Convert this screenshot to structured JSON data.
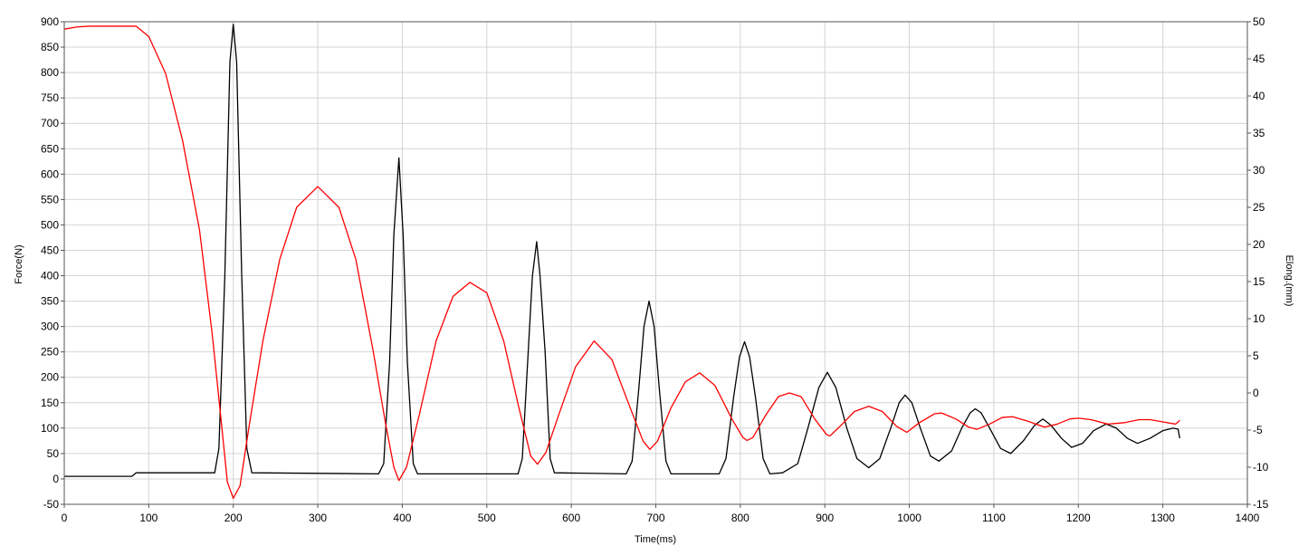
{
  "chart_data": {
    "type": "line",
    "title": "",
    "xlabel": "Time(ms)",
    "ylabel": "Force(N)",
    "y2label": "Elong.(mm)",
    "xlim": [
      0,
      1400
    ],
    "ylim": [
      -50,
      900
    ],
    "y2lim": [
      -15,
      50
    ],
    "grid": true,
    "x_ticks": [
      "0",
      "100",
      "200",
      "300",
      "400",
      "500",
      "600",
      "700",
      "800",
      "900",
      "1000",
      "1100",
      "1200",
      "1300",
      "1400"
    ],
    "y_ticks": [
      "-50",
      "0",
      "50",
      "100",
      "150",
      "200",
      "250",
      "300",
      "350",
      "400",
      "450",
      "500",
      "550",
      "600",
      "650",
      "700",
      "750",
      "800",
      "850",
      "900"
    ],
    "y2_ticks": [
      "-15",
      "-10",
      "-5",
      "0",
      "5",
      "10",
      "15",
      "20",
      "25",
      "30",
      "35",
      "40",
      "45",
      "50"
    ],
    "series": [
      {
        "axis": "left",
        "color": "#000000",
        "points": [
          [
            0,
            5
          ],
          [
            80,
            5
          ],
          [
            85,
            12
          ],
          [
            178,
            12
          ],
          [
            183,
            60
          ],
          [
            190,
            400
          ],
          [
            196,
            820
          ],
          [
            200,
            895
          ],
          [
            204,
            820
          ],
          [
            210,
            400
          ],
          [
            216,
            60
          ],
          [
            222,
            12
          ],
          [
            372,
            10
          ],
          [
            378,
            30
          ],
          [
            385,
            230
          ],
          [
            390,
            480
          ],
          [
            396,
            632
          ],
          [
            401,
            480
          ],
          [
            406,
            230
          ],
          [
            413,
            30
          ],
          [
            418,
            10
          ],
          [
            537,
            10
          ],
          [
            542,
            40
          ],
          [
            549,
            250
          ],
          [
            554,
            400
          ],
          [
            559,
            467
          ],
          [
            563,
            400
          ],
          [
            569,
            250
          ],
          [
            575,
            40
          ],
          [
            580,
            12
          ],
          [
            665,
            10
          ],
          [
            672,
            35
          ],
          [
            680,
            180
          ],
          [
            686,
            300
          ],
          [
            692,
            350
          ],
          [
            698,
            300
          ],
          [
            704,
            180
          ],
          [
            712,
            35
          ],
          [
            718,
            10
          ],
          [
            775,
            10
          ],
          [
            783,
            40
          ],
          [
            792,
            160
          ],
          [
            799,
            240
          ],
          [
            805,
            270
          ],
          [
            811,
            240
          ],
          [
            818,
            160
          ],
          [
            827,
            40
          ],
          [
            835,
            10
          ],
          [
            850,
            12
          ],
          [
            868,
            30
          ],
          [
            880,
            100
          ],
          [
            893,
            180
          ],
          [
            903,
            210
          ],
          [
            913,
            180
          ],
          [
            926,
            100
          ],
          [
            938,
            40
          ],
          [
            952,
            22
          ],
          [
            965,
            40
          ],
          [
            978,
            100
          ],
          [
            988,
            150
          ],
          [
            995,
            165
          ],
          [
            1003,
            150
          ],
          [
            1013,
            100
          ],
          [
            1025,
            45
          ],
          [
            1035,
            35
          ],
          [
            1050,
            55
          ],
          [
            1062,
            100
          ],
          [
            1072,
            130
          ],
          [
            1078,
            138
          ],
          [
            1085,
            130
          ],
          [
            1095,
            100
          ],
          [
            1108,
            60
          ],
          [
            1120,
            50
          ],
          [
            1135,
            75
          ],
          [
            1148,
            105
          ],
          [
            1158,
            118
          ],
          [
            1168,
            105
          ],
          [
            1180,
            80
          ],
          [
            1192,
            62
          ],
          [
            1205,
            70
          ],
          [
            1218,
            95
          ],
          [
            1233,
            108
          ],
          [
            1245,
            100
          ],
          [
            1258,
            80
          ],
          [
            1270,
            70
          ],
          [
            1285,
            80
          ],
          [
            1300,
            95
          ],
          [
            1312,
            100
          ],
          [
            1318,
            98
          ],
          [
            1320,
            80
          ]
        ]
      },
      {
        "axis": "right",
        "color": "#ff0000",
        "points": [
          [
            0,
            49.0
          ],
          [
            15,
            49.3
          ],
          [
            30,
            49.4
          ],
          [
            85,
            49.4
          ],
          [
            100,
            48.0
          ],
          [
            120,
            43.0
          ],
          [
            140,
            34.0
          ],
          [
            160,
            22.0
          ],
          [
            175,
            8.0
          ],
          [
            185,
            -3.0
          ],
          [
            193,
            -12.0
          ],
          [
            200,
            -14.2
          ],
          [
            208,
            -12.5
          ],
          [
            218,
            -5.0
          ],
          [
            235,
            7.0
          ],
          [
            255,
            18.0
          ],
          [
            275,
            25.0
          ],
          [
            300,
            27.8
          ],
          [
            325,
            25.0
          ],
          [
            345,
            18.0
          ],
          [
            365,
            6.0
          ],
          [
            380,
            -4.0
          ],
          [
            390,
            -10.0
          ],
          [
            396,
            -11.8
          ],
          [
            405,
            -10.0
          ],
          [
            420,
            -3.0
          ],
          [
            440,
            7.0
          ],
          [
            460,
            13.0
          ],
          [
            480,
            14.9
          ],
          [
            500,
            13.5
          ],
          [
            520,
            7.0
          ],
          [
            538,
            -2.0
          ],
          [
            552,
            -8.5
          ],
          [
            560,
            -9.6
          ],
          [
            570,
            -8.0
          ],
          [
            585,
            -3.0
          ],
          [
            605,
            3.5
          ],
          [
            627,
            7.0
          ],
          [
            648,
            4.5
          ],
          [
            668,
            -1.5
          ],
          [
            685,
            -6.5
          ],
          [
            693,
            -7.6
          ],
          [
            702,
            -6.5
          ],
          [
            718,
            -2.0
          ],
          [
            735,
            1.5
          ],
          [
            752,
            2.7
          ],
          [
            770,
            1.0
          ],
          [
            790,
            -3.5
          ],
          [
            803,
            -6.0
          ],
          [
            808,
            -6.4
          ],
          [
            815,
            -6.0
          ],
          [
            830,
            -3.0
          ],
          [
            845,
            -0.5
          ],
          [
            858,
            0.0
          ],
          [
            872,
            -0.5
          ],
          [
            888,
            -3.5
          ],
          [
            902,
            -5.6
          ],
          [
            906,
            -5.8
          ],
          [
            918,
            -4.5
          ],
          [
            935,
            -2.5
          ],
          [
            952,
            -1.8
          ],
          [
            968,
            -2.5
          ],
          [
            985,
            -4.5
          ],
          [
            997,
            -5.3
          ],
          [
            1012,
            -4.0
          ],
          [
            1030,
            -2.8
          ],
          [
            1038,
            -2.7
          ],
          [
            1055,
            -3.5
          ],
          [
            1070,
            -4.6
          ],
          [
            1080,
            -4.9
          ],
          [
            1095,
            -4.2
          ],
          [
            1110,
            -3.3
          ],
          [
            1122,
            -3.2
          ],
          [
            1140,
            -3.8
          ],
          [
            1160,
            -4.6
          ],
          [
            1175,
            -4.2
          ],
          [
            1190,
            -3.5
          ],
          [
            1200,
            -3.4
          ],
          [
            1215,
            -3.6
          ],
          [
            1235,
            -4.2
          ],
          [
            1255,
            -4.0
          ],
          [
            1272,
            -3.6
          ],
          [
            1285,
            -3.6
          ],
          [
            1300,
            -3.9
          ],
          [
            1315,
            -4.2
          ],
          [
            1320,
            -3.7
          ]
        ]
      }
    ]
  }
}
